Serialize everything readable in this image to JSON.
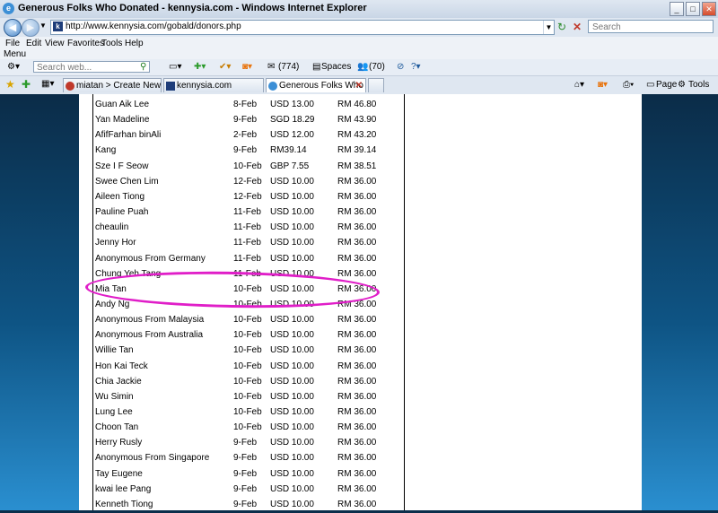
{
  "window": {
    "title": "Generous Folks Who Donated - kennysia.com - Windows Internet Explorer",
    "minimize": "_",
    "maximize": "□",
    "close": "✕"
  },
  "address": {
    "url": "http://www.kennysia.com/gobald/donors.php",
    "search_placeholder": "Search"
  },
  "menu": {
    "items": [
      "File",
      "Edit",
      "View",
      "Favorites",
      "Tools",
      "Help"
    ],
    "label": "Menu"
  },
  "toolbar": {
    "search_placeholder": "Search web...",
    "count1": "(774)",
    "spaces": "Spaces",
    "count2": "(70)"
  },
  "tabs": [
    {
      "label": "miatan > Create New Post —...",
      "active": false
    },
    {
      "label": "kennysia.com",
      "active": false
    },
    {
      "label": "Generous Folks Who Don...",
      "active": true
    }
  ],
  "commands": {
    "page": "Page",
    "tools": "Tools"
  },
  "donors": [
    {
      "name": "Guan Aik Lee",
      "date": "8-Feb",
      "amount": "USD 13.00",
      "rm": "RM 46.80"
    },
    {
      "name": "Yan Madeline",
      "date": "9-Feb",
      "amount": "SGD 18.29",
      "rm": "RM 43.90"
    },
    {
      "name": "AfifFarhan binAli",
      "date": "2-Feb",
      "amount": "USD 12.00",
      "rm": "RM 43.20"
    },
    {
      "name": "Kang",
      "date": "9-Feb",
      "amount": "RM39.14",
      "rm": "RM 39.14"
    },
    {
      "name": "Sze I F Seow",
      "date": "10-Feb",
      "amount": "GBP 7.55",
      "rm": "RM 38.51"
    },
    {
      "name": "Swee Chen Lim",
      "date": "12-Feb",
      "amount": "USD 10.00",
      "rm": "RM 36.00"
    },
    {
      "name": "Aileen Tiong",
      "date": "12-Feb",
      "amount": "USD 10.00",
      "rm": "RM 36.00"
    },
    {
      "name": "Pauline Puah",
      "date": "11-Feb",
      "amount": "USD 10.00",
      "rm": "RM 36.00"
    },
    {
      "name": "cheaulin",
      "date": "11-Feb",
      "amount": "USD 10.00",
      "rm": "RM 36.00"
    },
    {
      "name": "Jenny Hor",
      "date": "11-Feb",
      "amount": "USD 10.00",
      "rm": "RM 36.00"
    },
    {
      "name": "Anonymous From Germany",
      "date": "11-Feb",
      "amount": "USD 10.00",
      "rm": "RM 36.00"
    },
    {
      "name": "Chung Yeh Tang",
      "date": "11-Feb",
      "amount": "USD 10.00",
      "rm": "RM 36.00"
    },
    {
      "name": "Mia Tan",
      "date": "10-Feb",
      "amount": "USD 10.00",
      "rm": "RM 36.00"
    },
    {
      "name": "Andy Ng",
      "date": "10-Feb",
      "amount": "USD 10.00",
      "rm": "RM 36.00"
    },
    {
      "name": "Anonymous From Malaysia",
      "date": "10-Feb",
      "amount": "USD 10.00",
      "rm": "RM 36.00"
    },
    {
      "name": "Anonymous From Australia",
      "date": "10-Feb",
      "amount": "USD 10.00",
      "rm": "RM 36.00"
    },
    {
      "name": "Willie Tan",
      "date": "10-Feb",
      "amount": "USD 10.00",
      "rm": "RM 36.00"
    },
    {
      "name": "Hon Kai Teck",
      "date": "10-Feb",
      "amount": "USD 10.00",
      "rm": "RM 36.00"
    },
    {
      "name": "Chia Jackie",
      "date": "10-Feb",
      "amount": "USD 10.00",
      "rm": "RM 36.00"
    },
    {
      "name": "Wu Simin",
      "date": "10-Feb",
      "amount": "USD 10.00",
      "rm": "RM 36.00"
    },
    {
      "name": "Lung Lee",
      "date": "10-Feb",
      "amount": "USD 10.00",
      "rm": "RM 36.00"
    },
    {
      "name": "Choon Tan",
      "date": "10-Feb",
      "amount": "USD 10.00",
      "rm": "RM 36.00"
    },
    {
      "name": "Herry Rusly",
      "date": "9-Feb",
      "amount": "USD 10.00",
      "rm": "RM 36.00"
    },
    {
      "name": "Anonymous From Singapore",
      "date": "9-Feb",
      "amount": "USD 10.00",
      "rm": "RM 36.00"
    },
    {
      "name": "Tay Eugene",
      "date": "9-Feb",
      "amount": "USD 10.00",
      "rm": "RM 36.00"
    },
    {
      "name": "kwai lee Pang",
      "date": "9-Feb",
      "amount": "USD 10.00",
      "rm": "RM 36.00"
    },
    {
      "name": "Kenneth Tiong",
      "date": "9-Feb",
      "amount": "USD 10.00",
      "rm": "RM 36.00"
    }
  ],
  "highlight_color": "#e01ec8"
}
